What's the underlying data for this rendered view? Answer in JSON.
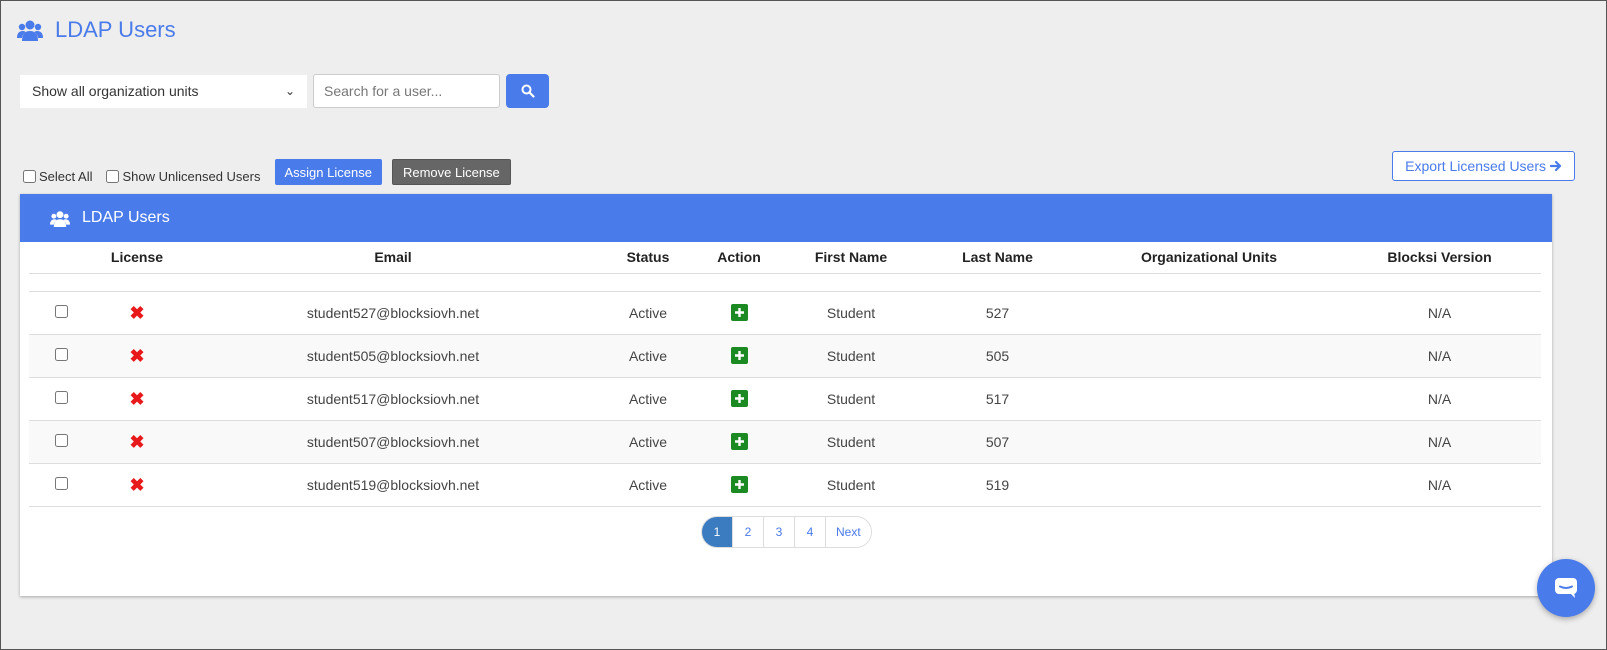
{
  "page": {
    "title": "LDAP Users"
  },
  "filters": {
    "ou_select_value": "Show all organization units",
    "search_placeholder": "Search for a user..."
  },
  "toolbar": {
    "select_all_label": "Select All",
    "show_unlicensed_label": "Show Unlicensed Users",
    "assign_label": "Assign License",
    "remove_label": "Remove License",
    "export_label": "Export Licensed Users"
  },
  "panel": {
    "title": "LDAP Users"
  },
  "table": {
    "headers": [
      "License",
      "Email",
      "Status",
      "Action",
      "First Name",
      "Last Name",
      "Organizational Units",
      "Blocksi Version"
    ],
    "rows": [
      {
        "email": "student527@blocksiovh.net",
        "status": "Active",
        "first": "Student",
        "last": "527",
        "ou": "",
        "version": "N/A"
      },
      {
        "email": "student505@blocksiovh.net",
        "status": "Active",
        "first": "Student",
        "last": "505",
        "ou": "",
        "version": "N/A"
      },
      {
        "email": "student517@blocksiovh.net",
        "status": "Active",
        "first": "Student",
        "last": "517",
        "ou": "",
        "version": "N/A"
      },
      {
        "email": "student507@blocksiovh.net",
        "status": "Active",
        "first": "Student",
        "last": "507",
        "ou": "",
        "version": "N/A"
      },
      {
        "email": "student519@blocksiovh.net",
        "status": "Active",
        "first": "Student",
        "last": "519",
        "ou": "",
        "version": "N/A"
      }
    ]
  },
  "pagination": {
    "pages": [
      "1",
      "2",
      "3",
      "4"
    ],
    "next": "Next",
    "current": "1"
  },
  "colors": {
    "accent": "#4a7bea",
    "danger": "#e8191b",
    "success": "#1b8a22"
  },
  "icons": {
    "users": "users-icon",
    "search": "search-icon",
    "license_missing": "x-icon",
    "action_add": "plus-square-icon",
    "chat": "chat-icon",
    "export": "arrow-right-icon"
  }
}
